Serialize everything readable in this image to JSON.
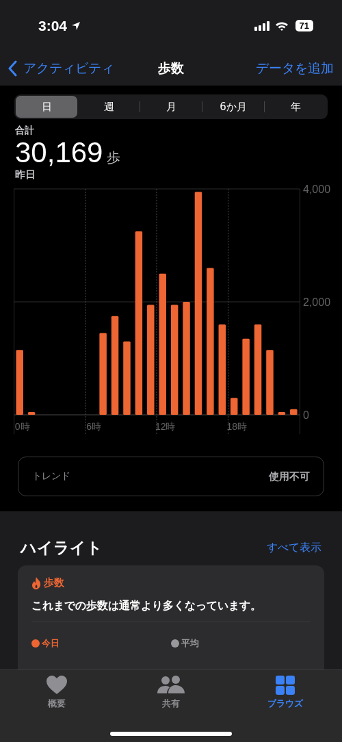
{
  "status_bar": {
    "time": "3:04",
    "battery": "71"
  },
  "nav": {
    "back": "アクティビティ",
    "title": "歩数",
    "action": "データを追加"
  },
  "segments": [
    {
      "label": "日",
      "selected": true
    },
    {
      "label": "週",
      "selected": false
    },
    {
      "label": "月",
      "selected": false
    },
    {
      "label": "6か月",
      "selected": false
    },
    {
      "label": "年",
      "selected": false
    }
  ],
  "summary": {
    "label": "合計",
    "value": "30,169",
    "unit": "歩",
    "date": "昨日"
  },
  "chart": {
    "chart_data": {
      "type": "bar",
      "x": [
        0,
        1,
        2,
        3,
        4,
        5,
        6,
        7,
        8,
        9,
        10,
        11,
        12,
        13,
        14,
        15,
        16,
        17,
        18,
        19,
        20,
        21,
        22,
        23
      ],
      "xlim": [
        -0.5,
        23.5
      ],
      "series": [
        {
          "color": "#ee6633",
          "values": [
            1150,
            50,
            0,
            0,
            0,
            0,
            0,
            1450,
            1750,
            1300,
            3250,
            1950,
            2500,
            1950,
            2000,
            3950,
            2600,
            1600,
            300,
            1350,
            1600,
            1150,
            50,
            100
          ]
        }
      ],
      "ylim": [
        0,
        4000
      ],
      "yticks": [
        {
          "value": 0,
          "label": "0"
        },
        {
          "value": 2000,
          "label": "2,000"
        },
        {
          "value": 4000,
          "label": "4,000"
        }
      ],
      "xticks": [
        {
          "value": 0,
          "label": "0時"
        },
        {
          "value": 6,
          "label": "6時"
        },
        {
          "value": 12,
          "label": "12時"
        },
        {
          "value": 18,
          "label": "18時"
        }
      ]
    }
  },
  "trend": {
    "label": "トレンド",
    "value": "使用不可"
  },
  "highlights": {
    "title": "ハイライト",
    "link": "すべて表示",
    "card": {
      "category": "歩数",
      "text": "これまでの歩数は通常より多くなっています。",
      "legend": [
        {
          "label": "今日",
          "color": "#ee6633"
        },
        {
          "label": "平均",
          "color": "#98989d"
        }
      ]
    }
  },
  "tab_bar": [
    {
      "kind": "heart",
      "label": "概要",
      "selected": false
    },
    {
      "kind": "people",
      "label": "共有",
      "selected": false
    },
    {
      "kind": "grid",
      "label": "ブラウズ",
      "selected": true
    }
  ]
}
